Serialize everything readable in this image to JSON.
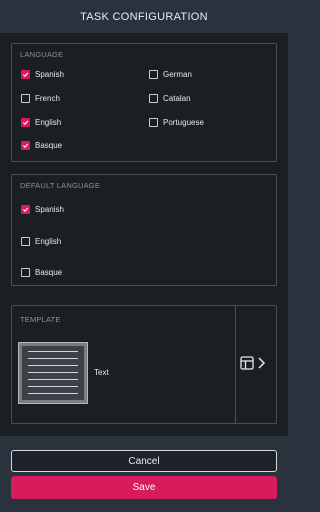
{
  "header": {
    "title": "TASK CONFIGURATION"
  },
  "language": {
    "title": "LANGUAGE",
    "options": [
      {
        "label": "Spanish",
        "checked": true
      },
      {
        "label": "German",
        "checked": false
      },
      {
        "label": "French",
        "checked": false
      },
      {
        "label": "Catalan",
        "checked": false
      },
      {
        "label": "English",
        "checked": true
      },
      {
        "label": "Portuguese",
        "checked": false
      },
      {
        "label": "Basque",
        "checked": true
      }
    ]
  },
  "default_language": {
    "title": "DEFAULT LANGUAGE",
    "options": [
      {
        "label": "Spanish",
        "checked": true
      },
      {
        "label": "English",
        "checked": false
      },
      {
        "label": "Basque",
        "checked": false
      }
    ]
  },
  "template": {
    "title": "TEMPLATE",
    "name": "Text",
    "action_icons": [
      "layout-icon",
      "chevron-right-icon"
    ]
  },
  "footer": {
    "cancel_label": "Cancel",
    "save_label": "Save"
  },
  "colors": {
    "accent": "#d81b5a",
    "background": "#1b1f24",
    "header": "#2a323d",
    "border": "#47505b"
  }
}
